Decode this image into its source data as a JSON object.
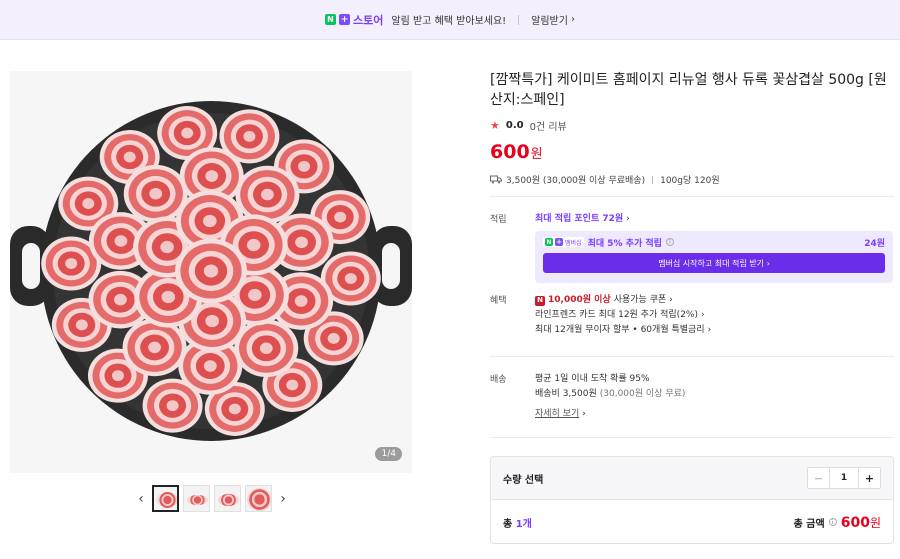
{
  "banner": {
    "store_name": "스토어",
    "message": "알림 받고 혜택 받아보세요!",
    "alert_link": "알림받기",
    "chevron": "›"
  },
  "gallery": {
    "counter_current": "1",
    "counter_sep": "/",
    "counter_total": "4",
    "prev_arrow": "‹",
    "next_arrow": "›"
  },
  "product": {
    "title": "[깜짝특가] 케이미트 홈페이지 리뉴얼 행사 듀록 꽃삼겹살 500g [원산지:스페인]",
    "rating": "0.0",
    "reviews": "0건 리뷰",
    "price": "600",
    "currency": "원",
    "shipping": "3,500원 (30,000원 이상 무료배송)",
    "unit_price": "100g당 120원"
  },
  "points": {
    "label": "적립",
    "max_point": "최대 적립 포인트 72원",
    "chip_label": "멤버십",
    "extra": "최대 5% 추가 적립",
    "extra_amount": "24원",
    "cta": "멤버십 시작하고 최대 적립 받기"
  },
  "benefits": {
    "label": "혜택",
    "coupon_amount": "10,000원 이상",
    "coupon_text": "사용가능 쿠폰",
    "card": "라인프렌즈 카드 최대 12원 추가 적립(2%)",
    "installment": "최대 12개월 무이자 할부 • 60개월 특별금리"
  },
  "delivery": {
    "label": "배송",
    "arrival": "평균 1일 이내 도착 확률 95%",
    "fee_label": "배송비 3,500원",
    "fee_note": "(30,000원 이상 무료)",
    "detail_link": "자세히 보기"
  },
  "quantity": {
    "label": "수량 선택",
    "minus": "−",
    "value": "1",
    "plus": "+",
    "total_label": "총",
    "total_count": "1개",
    "amount_label": "총 금액",
    "amount": "600",
    "currency": "원"
  },
  "colors": {
    "accent": "#7a3cff",
    "price": "#e8001c",
    "banner_bg": "#f3effc"
  }
}
